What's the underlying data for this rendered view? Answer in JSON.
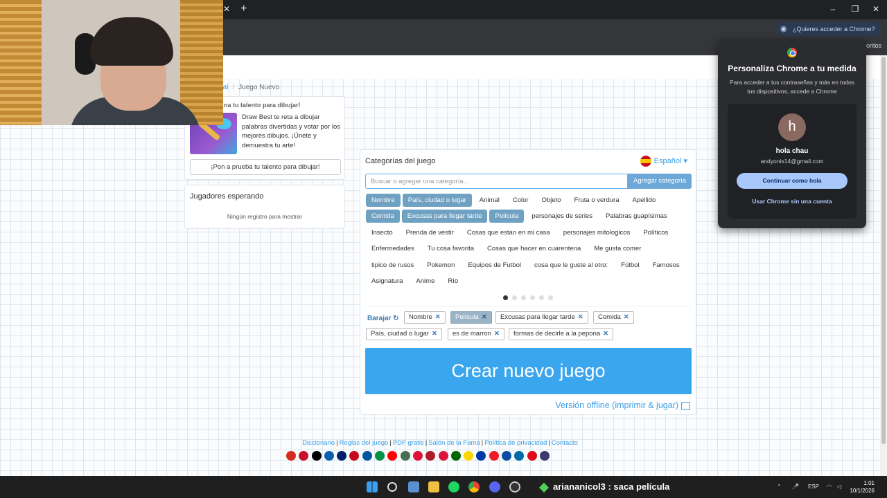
{
  "browser": {
    "signin_prompt": "¿Quieres acceder a Chrome?",
    "bookmarks_overflow": "oritos"
  },
  "breadcrumb": {
    "home": "pal",
    "current": "Juego Nuevo"
  },
  "promo": {
    "title": "na tu talento para dibujar!",
    "text": "Draw Best te reta a dibujar palabras divertidas y votar por los mejores dibujos. ¡Únete y demuestra tu arte!",
    "button": "¡Pon a prueba tu talento para dibujar!"
  },
  "players": {
    "title": "Jugadores esperando",
    "empty": "Ningún registro para mostrar"
  },
  "game": {
    "heading": "Categorías del juego",
    "language": "Español",
    "search_placeholder": "Buscar o agregar una categoría...",
    "add_button": "Agregar categoría",
    "categories": [
      {
        "label": "Nombre",
        "selected": true
      },
      {
        "label": "País, ciudad o lugar",
        "selected": true
      },
      {
        "label": "Animal",
        "selected": false
      },
      {
        "label": "Color",
        "selected": false
      },
      {
        "label": "Objeto",
        "selected": false
      },
      {
        "label": "Fruta o verdura",
        "selected": false
      },
      {
        "label": "Apellido",
        "selected": false
      },
      {
        "label": "Comida",
        "selected": true
      },
      {
        "label": "Excusas para llegar tarde",
        "selected": true
      },
      {
        "label": "Película",
        "selected": true
      },
      {
        "label": "personajes de series",
        "selected": false
      },
      {
        "label": "Palabras guapísimas",
        "selected": false
      },
      {
        "label": "Insecto",
        "selected": false
      },
      {
        "label": "Prenda de vestir",
        "selected": false
      },
      {
        "label": "Cosas que estan en mi casa",
        "selected": false
      },
      {
        "label": "personajes mitologicos",
        "selected": false
      },
      {
        "label": "Políticos",
        "selected": false
      },
      {
        "label": "Enfermedades",
        "selected": false
      },
      {
        "label": "Tu cosa favorita",
        "selected": false
      },
      {
        "label": "Cosas que hacer en cuarentena",
        "selected": false
      },
      {
        "label": "Me gusta comer",
        "selected": false
      },
      {
        "label": "tipico de rusos",
        "selected": false
      },
      {
        "label": "Pokemon",
        "selected": false
      },
      {
        "label": "Equipos de Futbol",
        "selected": false
      },
      {
        "label": "cosa que le guste al otro:",
        "selected": false
      },
      {
        "label": "Fútbol",
        "selected": false
      },
      {
        "label": "Famosos",
        "selected": false
      },
      {
        "label": "Asignatura",
        "selected": false
      },
      {
        "label": "Anime",
        "selected": false
      },
      {
        "label": "Río",
        "selected": false
      }
    ],
    "page_dots": 6,
    "active_dot": 0,
    "shuffle_label": "Barajar",
    "chosen": [
      {
        "label": "Nombre",
        "hover": false
      },
      {
        "label": "Película",
        "hover": true
      },
      {
        "label": "Excusas para llegar tarde",
        "hover": false
      },
      {
        "label": "Comida",
        "hover": false
      },
      {
        "label": "País, ciudad o lugar",
        "hover": false
      },
      {
        "label": "es de marron",
        "hover": false
      },
      {
        "label": "formas de decirle a la pepona",
        "hover": false
      }
    ],
    "create_button": "Crear nuevo juego",
    "offline_link": "Versión offline (imprimir & jugar)"
  },
  "footer": {
    "links": [
      "Diccionario",
      "Reglas del juego",
      "PDF gratis",
      "Salón de la Fama",
      "Política de privacidad",
      "Contacto"
    ],
    "flag_colors": [
      "#d52b1e",
      "#c8102e",
      "#000000",
      "#0d5eaf",
      "#012169",
      "#c60b1e",
      "#0055a4",
      "#009246",
      "#ff0000",
      "#477050",
      "#dc143c",
      "#ae1c28",
      "#dc143c",
      "#006600",
      "#ffd500",
      "#0039a6",
      "#ee1c25",
      "#0b4ea2",
      "#006aa7",
      "#e30a17",
      "#3c3b6e"
    ]
  },
  "chrome_popup": {
    "title": "Personaliza Chrome a tu medida",
    "subtitle": "Para acceder a tus contraseñas y más en todos tus dispositivos, accede a Chrome",
    "avatar_letter": "h",
    "name": "hola chau",
    "email": "andyonis14@gmail.com",
    "continue_button": "Continuar como hola",
    "without_account": "Usar Chrome sin una cuenta"
  },
  "taskbar": {
    "stream_message": "ariananicol3 : saca película",
    "lang": "ESP",
    "time": "1:01",
    "date": "10/1/2026"
  }
}
